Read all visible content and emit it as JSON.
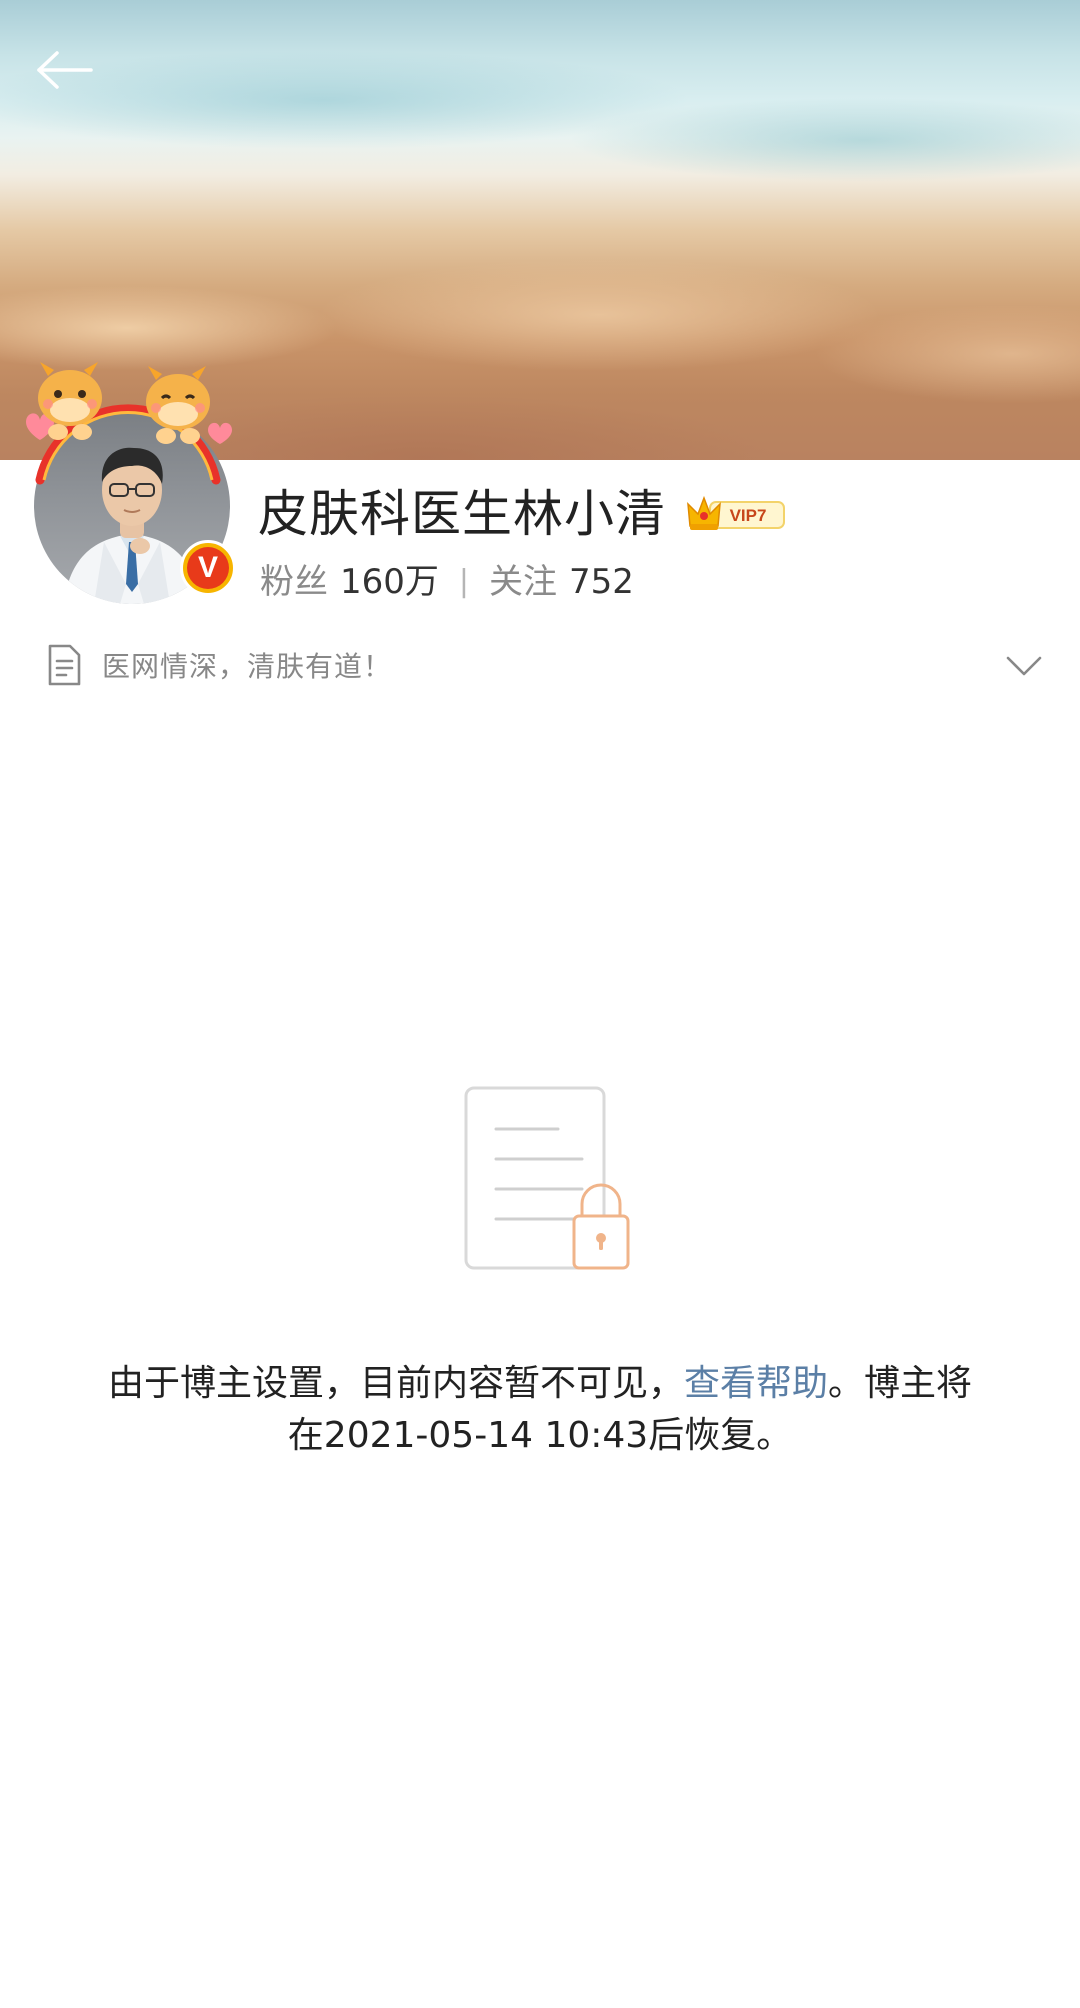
{
  "profile": {
    "username": "皮肤科医生林小清",
    "vip_label": "VIP7",
    "verified_mark": "V",
    "fans_label": "粉丝",
    "fans_count": "160万",
    "stat_separator": "|",
    "following_label": "关注",
    "following_count": "752",
    "bio": "医网情深，清肤有道！"
  },
  "empty_state": {
    "message_before_link": "由于博主设置，目前内容暂不可见，",
    "link_text": "查看帮助",
    "message_after_link": "。博主将在2021-05-14 10:43后恢复。"
  },
  "icons": {
    "back": "back-arrow-icon",
    "bio": "document-icon",
    "expand": "chevron-down-icon",
    "empty": "locked-document-icon"
  },
  "colors": {
    "link": "#5b7fa6",
    "verified_badge": "#e83a1a",
    "vip_gold": "#f7b500",
    "lock_orange": "#f0b48a"
  }
}
